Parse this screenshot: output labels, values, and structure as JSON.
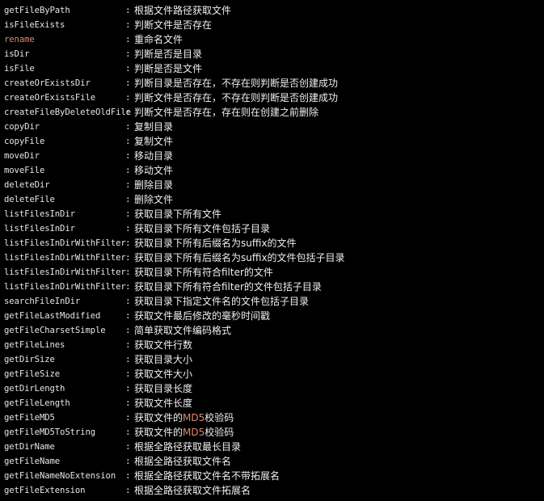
{
  "highlight_color": "#d98a6a",
  "text_color": "#e6e6e6",
  "background_color": "#000000",
  "separator": ":",
  "rows": [
    {
      "name": "getFileByPath",
      "desc": "根据文件路径获取文件"
    },
    {
      "name": "isFileExists",
      "desc": "判断文件是否存在"
    },
    {
      "name": "rename",
      "desc": "重命名文件",
      "highlight": true
    },
    {
      "name": "isDir",
      "desc": "判断是否是目录"
    },
    {
      "name": "isFile",
      "desc": "判断是否是文件"
    },
    {
      "name": "createOrExistsDir",
      "desc": "判断目录是否存在，不存在则判断是否创建成功"
    },
    {
      "name": "createOrExistsFile",
      "desc": "判断文件是否存在，不存在则判断是否创建成功"
    },
    {
      "name": "createFileByDeleteOldFile",
      "desc": "判断文件是否存在，存在则在创建之前删除"
    },
    {
      "name": "copyDir",
      "desc": "复制目录"
    },
    {
      "name": "copyFile",
      "desc": "复制文件"
    },
    {
      "name": "moveDir",
      "desc": "移动目录"
    },
    {
      "name": "moveFile",
      "desc": "移动文件"
    },
    {
      "name": "deleteDir",
      "desc": "删除目录"
    },
    {
      "name": "deleteFile",
      "desc": "删除文件"
    },
    {
      "name": "listFilesInDir",
      "desc": "获取目录下所有文件"
    },
    {
      "name": "listFilesInDir",
      "desc": "获取目录下所有文件包括子目录"
    },
    {
      "name": "listFilesInDirWithFilter",
      "desc": "获取目录下所有后缀名为suffix的文件"
    },
    {
      "name": "listFilesInDirWithFilter",
      "desc": "获取目录下所有后缀名为suffix的文件包括子目录"
    },
    {
      "name": "listFilesInDirWithFilter",
      "desc": "获取目录下所有符合filter的文件"
    },
    {
      "name": "listFilesInDirWithFilter",
      "desc": "获取目录下所有符合filter的文件包括子目录"
    },
    {
      "name": "searchFileInDir",
      "desc": "获取目录下指定文件名的文件包括子目录"
    },
    {
      "name": "getFileLastModified",
      "desc": "获取文件最后修改的毫秒时间戳"
    },
    {
      "name": "getFileCharsetSimple",
      "desc": "简单获取文件编码格式"
    },
    {
      "name": "getFileLines",
      "desc": "获取文件行数"
    },
    {
      "name": "getDirSize",
      "desc": "获取目录大小"
    },
    {
      "name": "getFileSize",
      "desc": "获取文件大小"
    },
    {
      "name": "getDirLength",
      "desc": "获取目录长度"
    },
    {
      "name": "getFileLength",
      "desc": "获取文件长度"
    },
    {
      "name": "getFileMD5",
      "desc_parts": [
        "获取文件的",
        "MD5",
        "校验码"
      ]
    },
    {
      "name": "getFileMD5ToString",
      "desc_parts": [
        "获取文件的",
        "MD5",
        "校验码"
      ]
    },
    {
      "name": "getDirName",
      "desc": "根据全路径获取最长目录"
    },
    {
      "name": "getFileName",
      "desc": "根据全路径获取文件名"
    },
    {
      "name": "getFileNameNoExtension",
      "desc": "根据全路径获取文件名不带拓展名"
    },
    {
      "name": "getFileExtension",
      "desc": "根据全路径获取文件拓展名"
    }
  ]
}
